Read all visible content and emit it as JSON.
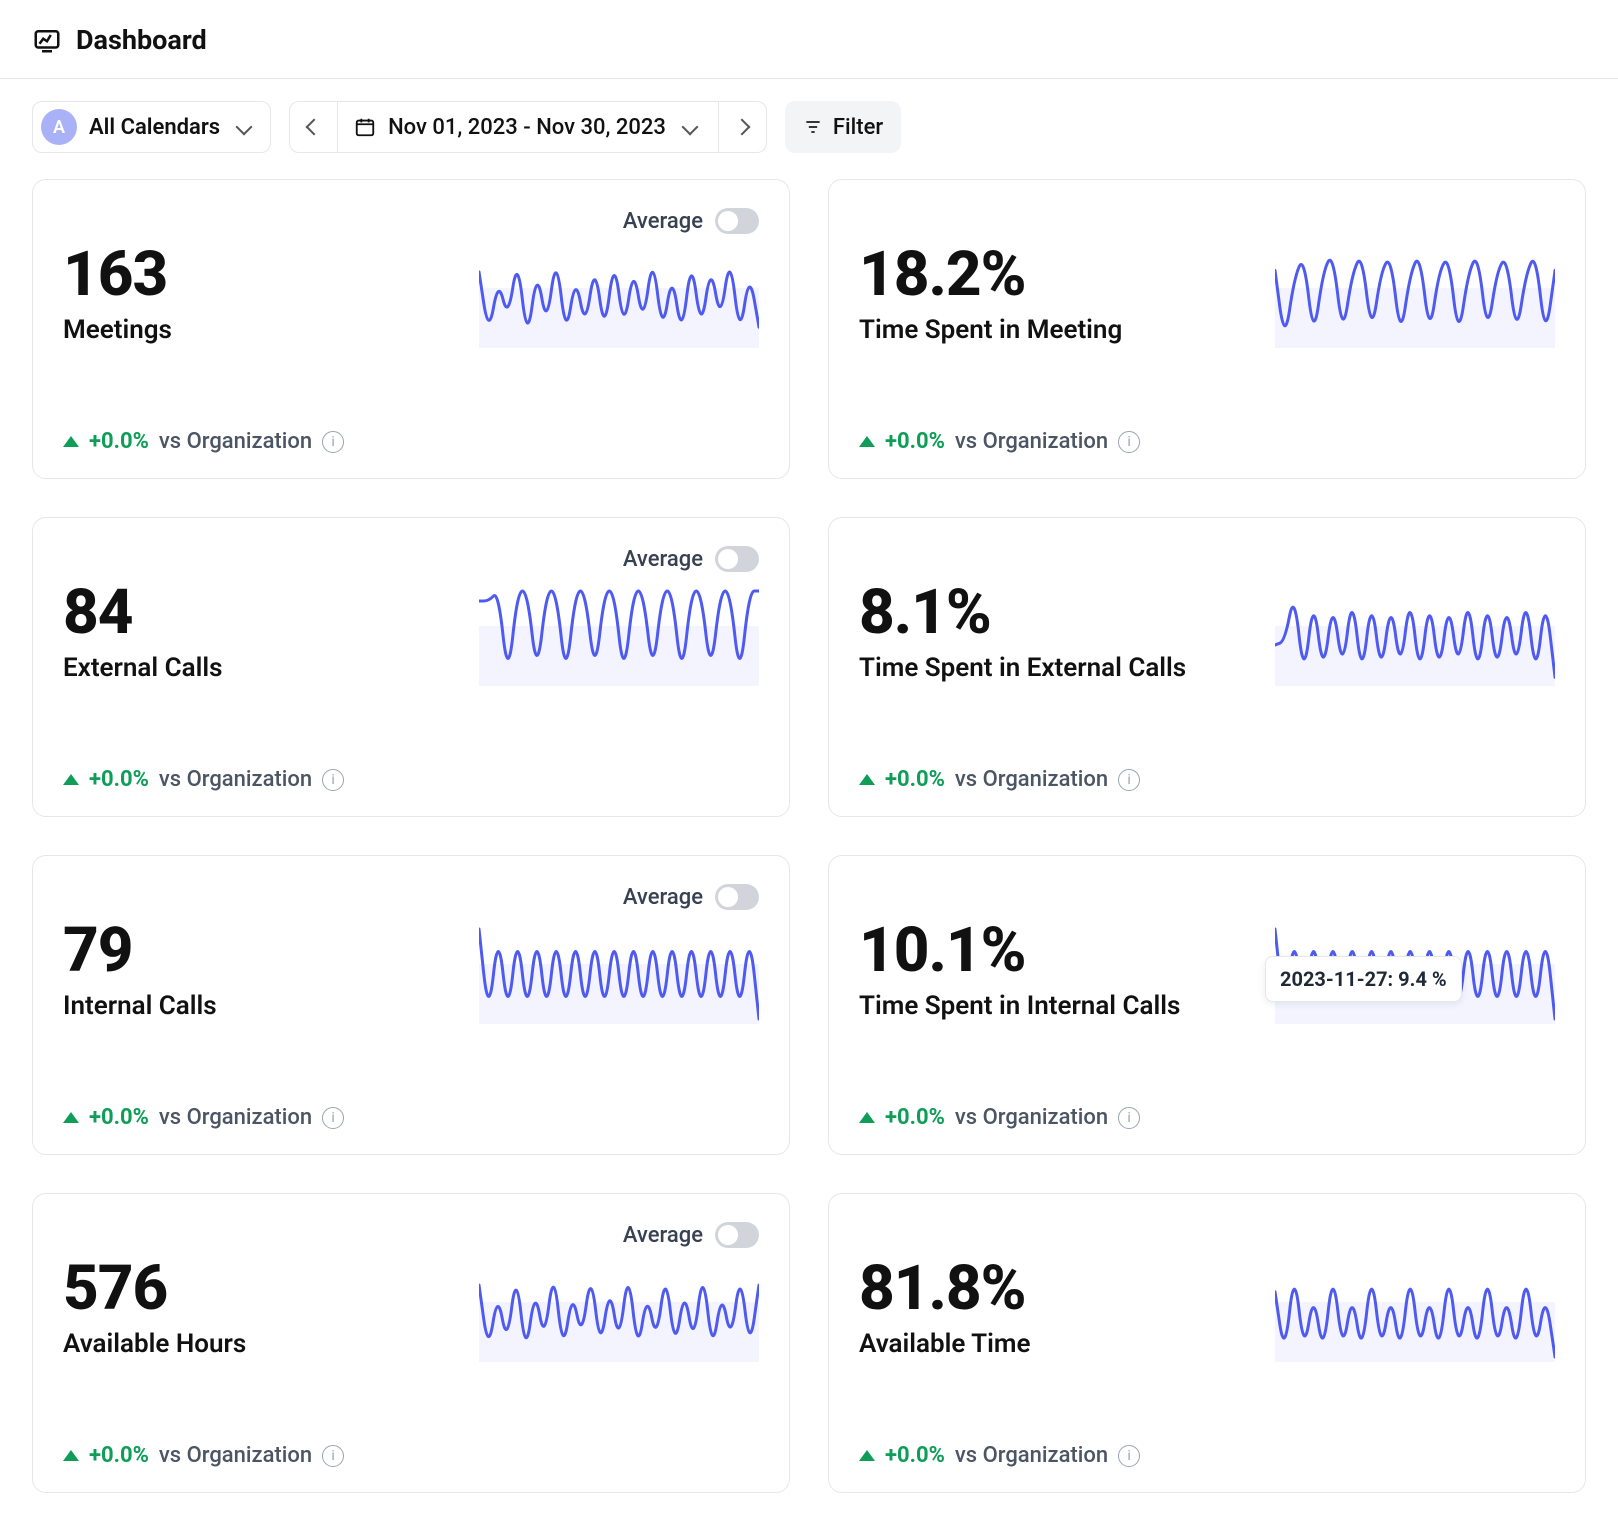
{
  "header": {
    "title": "Dashboard"
  },
  "controls": {
    "avatar_letter": "A",
    "calendars_label": "All Calendars",
    "date_range": "Nov 01, 2023 - Nov 30, 2023",
    "filter_label": "Filter"
  },
  "common": {
    "average_label": "Average",
    "vs_label": "vs Organization",
    "info_glyph": "i"
  },
  "cards": [
    {
      "value": "163",
      "label": "Meetings",
      "delta": "+0.0%",
      "show_avg_toggle": true,
      "spark": [
        60,
        20,
        55,
        30,
        70,
        15,
        62,
        25,
        72,
        18,
        58,
        24,
        66,
        20,
        70,
        22,
        64,
        26,
        72,
        20,
        60,
        18,
        70,
        22,
        65,
        28,
        72,
        18,
        60,
        25
      ]
    },
    {
      "value": "18.2%",
      "label": "Time Spent in Meeting",
      "delta": "+0.0%",
      "show_avg_toggle": false,
      "spark": [
        60,
        10,
        55,
        70,
        12,
        60,
        72,
        14,
        58,
        72,
        15,
        60,
        70,
        12,
        58,
        72,
        14,
        60,
        70,
        12,
        58,
        72,
        15,
        60,
        70,
        14,
        58,
        72,
        12,
        60
      ]
    },
    {
      "value": "84",
      "label": "External Calls",
      "delta": "+0.0%",
      "show_avg_toggle": true,
      "spark": [
        50,
        50,
        55,
        10,
        55,
        55,
        12,
        55,
        55,
        10,
        55,
        55,
        12,
        55,
        55,
        10,
        55,
        55,
        12,
        55,
        55,
        10,
        55,
        55,
        12,
        55,
        55,
        10,
        55,
        55
      ]
    },
    {
      "value": "8.1%",
      "label": "Time Spent in External Calls",
      "delta": "+0.0%",
      "show_avg_toggle": false,
      "spark": [
        40,
        42,
        70,
        20,
        68,
        22,
        66,
        24,
        70,
        20,
        68,
        22,
        66,
        24,
        70,
        20,
        68,
        22,
        66,
        24,
        70,
        20,
        68,
        22,
        66,
        24,
        70,
        20,
        68,
        22
      ]
    },
    {
      "value": "79",
      "label": "Internal Calls",
      "delta": "+0.0%",
      "show_avg_toggle": true,
      "spark": [
        70,
        10,
        70,
        10,
        70,
        10,
        70,
        10,
        70,
        10,
        70,
        10,
        70,
        10,
        70,
        10,
        70,
        10,
        70,
        10,
        70,
        10,
        70,
        10,
        70,
        10,
        70,
        10,
        70,
        10
      ]
    },
    {
      "value": "10.1%",
      "label": "Time Spent in Internal Calls",
      "delta": "+0.0%",
      "show_avg_toggle": false,
      "spark": [
        70,
        10,
        70,
        10,
        70,
        10,
        70,
        10,
        70,
        10,
        70,
        10,
        70,
        10,
        70,
        10,
        70,
        10,
        70,
        10,
        70,
        10,
        70,
        10,
        70,
        10,
        70,
        10,
        70,
        10
      ],
      "tooltip": "2023-11-27: 9.4 %"
    },
    {
      "value": "576",
      "label": "Available Hours",
      "delta": "+0.0%",
      "show_avg_toggle": true,
      "spark": [
        60,
        15,
        55,
        20,
        70,
        12,
        58,
        22,
        72,
        14,
        56,
        24,
        70,
        16,
        60,
        20,
        72,
        14,
        55,
        22,
        70,
        16,
        58,
        20,
        72,
        14,
        56,
        22,
        70,
        16,
        60
      ]
    },
    {
      "value": "81.8%",
      "label": "Available Time",
      "delta": "+0.0%",
      "show_avg_toggle": false,
      "spark": [
        55,
        10,
        72,
        12,
        55,
        10,
        72,
        12,
        55,
        10,
        72,
        12,
        55,
        10,
        72,
        12,
        55,
        10,
        72,
        12,
        55,
        10,
        72,
        12,
        55,
        10,
        72,
        12,
        55,
        10
      ]
    }
  ],
  "chart_data": [
    {
      "type": "line",
      "title": "Meetings",
      "value": 163,
      "unit": "count",
      "delta_pct": 0.0,
      "values": [
        60,
        20,
        55,
        30,
        70,
        15,
        62,
        25,
        72,
        18,
        58,
        24,
        66,
        20,
        70,
        22,
        64,
        26,
        72,
        20,
        60,
        18,
        70,
        22,
        65,
        28,
        72,
        18,
        60,
        25
      ]
    },
    {
      "type": "line",
      "title": "Time Spent in Meeting",
      "value": 18.2,
      "unit": "percent",
      "delta_pct": 0.0,
      "values": [
        60,
        10,
        55,
        70,
        12,
        60,
        72,
        14,
        58,
        72,
        15,
        60,
        70,
        12,
        58,
        72,
        14,
        60,
        70,
        12,
        58,
        72,
        15,
        60,
        70,
        14,
        58,
        72,
        12,
        60
      ]
    },
    {
      "type": "line",
      "title": "External Calls",
      "value": 84,
      "unit": "count",
      "delta_pct": 0.0,
      "values": [
        50,
        50,
        55,
        10,
        55,
        55,
        12,
        55,
        55,
        10,
        55,
        55,
        12,
        55,
        55,
        10,
        55,
        55,
        12,
        55,
        55,
        10,
        55,
        55,
        12,
        55,
        55,
        10,
        55,
        55
      ]
    },
    {
      "type": "line",
      "title": "Time Spent in External Calls",
      "value": 8.1,
      "unit": "percent",
      "delta_pct": 0.0,
      "values": [
        40,
        42,
        70,
        20,
        68,
        22,
        66,
        24,
        70,
        20,
        68,
        22,
        66,
        24,
        70,
        20,
        68,
        22,
        66,
        24,
        70,
        20,
        68,
        22,
        66,
        24,
        70,
        20,
        68,
        22
      ]
    },
    {
      "type": "line",
      "title": "Internal Calls",
      "value": 79,
      "unit": "count",
      "delta_pct": 0.0,
      "values": [
        70,
        10,
        70,
        10,
        70,
        10,
        70,
        10,
        70,
        10,
        70,
        10,
        70,
        10,
        70,
        10,
        70,
        10,
        70,
        10,
        70,
        10,
        70,
        10,
        70,
        10,
        70,
        10,
        70,
        10
      ]
    },
    {
      "type": "line",
      "title": "Time Spent in Internal Calls",
      "value": 10.1,
      "unit": "percent",
      "delta_pct": 0.0,
      "values": [
        70,
        10,
        70,
        10,
        70,
        10,
        70,
        10,
        70,
        10,
        70,
        10,
        70,
        10,
        70,
        10,
        70,
        10,
        70,
        10,
        70,
        10,
        70,
        10,
        70,
        10,
        70,
        10,
        70,
        10
      ],
      "tooltip": {
        "date": "2023-11-27",
        "value": 9.4
      }
    },
    {
      "type": "line",
      "title": "Available Hours",
      "value": 576,
      "unit": "count",
      "delta_pct": 0.0,
      "values": [
        60,
        15,
        55,
        20,
        70,
        12,
        58,
        22,
        72,
        14,
        56,
        24,
        70,
        16,
        60,
        20,
        72,
        14,
        55,
        22,
        70,
        16,
        58,
        20,
        72,
        14,
        56,
        22,
        70,
        16,
        60
      ]
    },
    {
      "type": "line",
      "title": "Available Time",
      "value": 81.8,
      "unit": "percent",
      "delta_pct": 0.0,
      "values": [
        55,
        10,
        72,
        12,
        55,
        10,
        72,
        12,
        55,
        10,
        72,
        12,
        55,
        10,
        72,
        12,
        55,
        10,
        72,
        12,
        55,
        10,
        72,
        12,
        55,
        10,
        72,
        12,
        55,
        10
      ]
    }
  ]
}
